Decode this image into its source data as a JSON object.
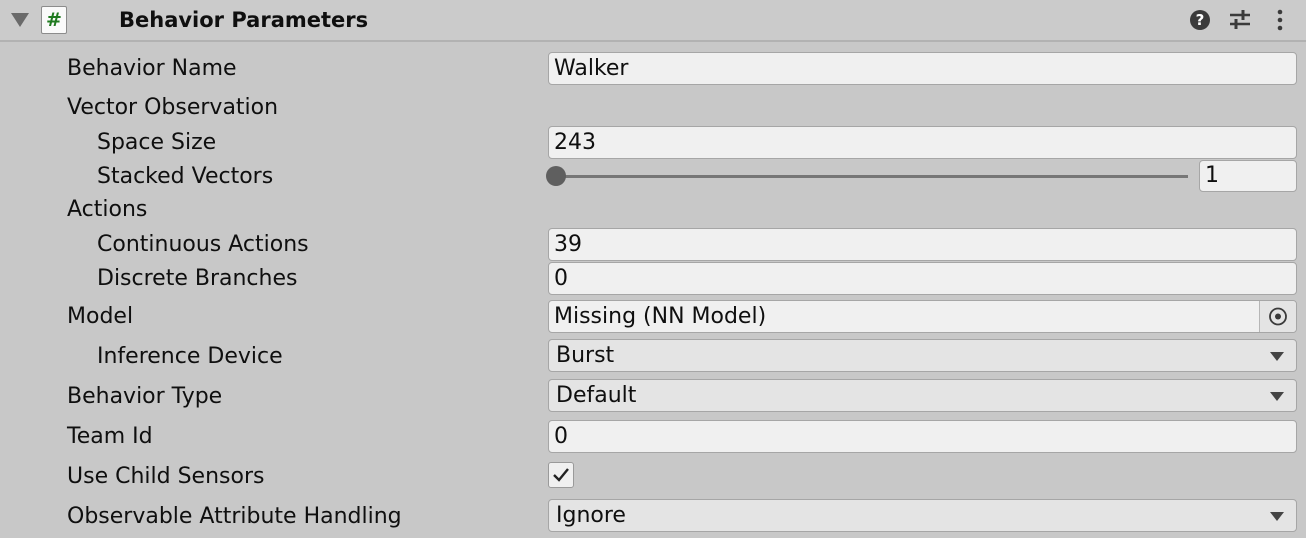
{
  "header": {
    "title": "Behavior Parameters",
    "script_icon_glyph": "#",
    "help_glyph": "?",
    "icons": [
      "foldout-arrow-icon",
      "script-icon",
      "help-icon",
      "presets-icon",
      "more-menu-icon"
    ]
  },
  "fields": {
    "behavior_name": {
      "label": "Behavior Name",
      "value": "Walker"
    },
    "vector_observation": {
      "label": "Vector Observation"
    },
    "space_size": {
      "label": "Space Size",
      "value": "243"
    },
    "stacked_vectors": {
      "label": "Stacked Vectors",
      "value": "1"
    },
    "actions": {
      "label": "Actions"
    },
    "continuous_actions": {
      "label": "Continuous Actions",
      "value": "39"
    },
    "discrete_branches": {
      "label": "Discrete Branches",
      "value": "0"
    },
    "model": {
      "label": "Model",
      "value": "Missing (NN Model)"
    },
    "inference_device": {
      "label": "Inference Device",
      "value": "Burst"
    },
    "behavior_type": {
      "label": "Behavior Type",
      "value": "Default"
    },
    "team_id": {
      "label": "Team Id",
      "value": "0"
    },
    "use_child_sensors": {
      "label": "Use Child Sensors",
      "checked": true
    },
    "observable_attribute_handling": {
      "label": "Observable Attribute Handling",
      "value": "Ignore"
    }
  },
  "colors": {
    "background": "#c8c8c8",
    "field": "#f0f0f0",
    "dropdown": "#e4e4e4",
    "script_hash": "#1f7a1f"
  }
}
